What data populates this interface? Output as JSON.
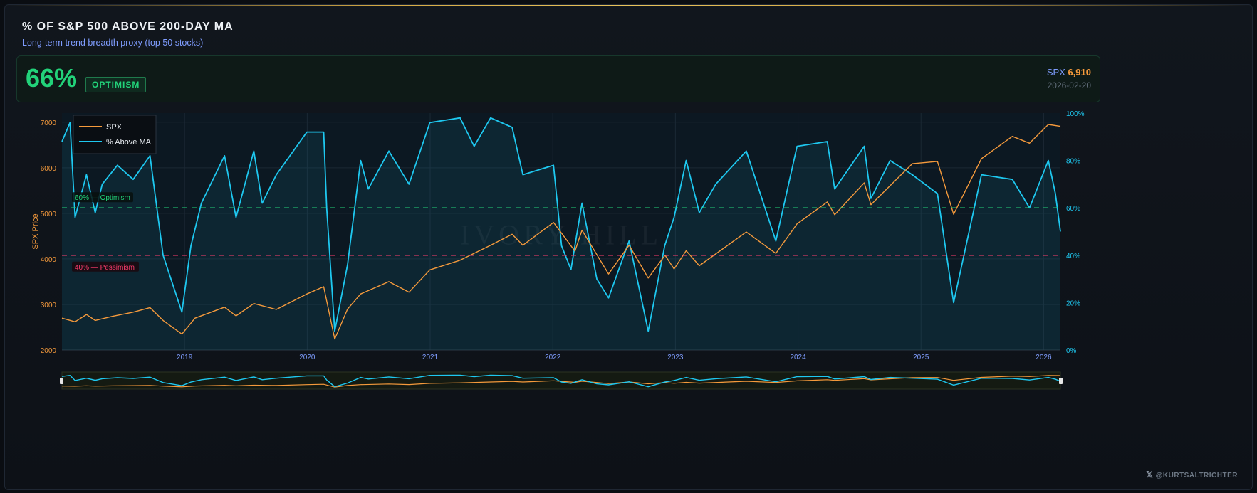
{
  "header": {
    "title": "% OF S&P 500 ABOVE 200-DAY MA",
    "subtitle": "Long-term trend breadth proxy (top 50 stocks)"
  },
  "status": {
    "percent": "66%",
    "badge": "OPTIMISM",
    "spx_label": "SPX",
    "spx_value": "6,910",
    "date": "2026-02-20"
  },
  "legend": {
    "spx": "SPX",
    "breadth": "% Above MA"
  },
  "thresholds": {
    "optimism_label": "60% — Optimism",
    "pessimism_label": "40% — Pessimism"
  },
  "watermark": "IVORY HILL",
  "footer": {
    "credit": "@KURTSALTRICHTER",
    "x_icon": "x-logo-icon"
  },
  "colors": {
    "spx": "#f59a3c",
    "breadth": "#1ec8f0",
    "optimism": "#22d37a",
    "pessimism": "#ff3d6e",
    "left_axis": "#f59a3c",
    "right_axis": "#1ec8f0",
    "x_axis": "#7f9dff"
  },
  "chart_data": {
    "type": "line",
    "title": "% OF S&P 500 ABOVE 200-DAY MA",
    "x_axis": {
      "type": "time",
      "range": [
        "2018-01-01",
        "2026-02-20"
      ],
      "ticks": [
        "2019",
        "2020",
        "2021",
        "2022",
        "2023",
        "2024",
        "2025",
        "2026"
      ]
    },
    "y_left": {
      "label": "SPX Price",
      "range": [
        2000,
        7200
      ],
      "ticks": [
        2000,
        3000,
        4000,
        5000,
        6000,
        7000
      ]
    },
    "y_right": {
      "range": [
        0,
        100
      ],
      "ticks": [
        "0%",
        "20%",
        "40%",
        "60%",
        "80%",
        "100%"
      ]
    },
    "thresholds": [
      {
        "value": 60,
        "label": "60% — Optimism"
      },
      {
        "value": 40,
        "label": "40% — Pessimism"
      }
    ],
    "grid": true,
    "legend": "top-left",
    "series": [
      {
        "name": "SPX",
        "axis": "left",
        "points": [
          [
            "2018-01-01",
            2700
          ],
          [
            "2018-02-09",
            2620
          ],
          [
            "2018-03-15",
            2780
          ],
          [
            "2018-04-10",
            2650
          ],
          [
            "2018-06-01",
            2740
          ],
          [
            "2018-08-01",
            2830
          ],
          [
            "2018-09-20",
            2930
          ],
          [
            "2018-10-29",
            2650
          ],
          [
            "2018-12-24",
            2350
          ],
          [
            "2019-02-01",
            2700
          ],
          [
            "2019-04-30",
            2940
          ],
          [
            "2019-06-03",
            2750
          ],
          [
            "2019-07-26",
            3020
          ],
          [
            "2019-10-01",
            2890
          ],
          [
            "2019-12-31",
            3230
          ],
          [
            "2020-02-19",
            3390
          ],
          [
            "2020-03-23",
            2240
          ],
          [
            "2020-04-30",
            2900
          ],
          [
            "2020-06-08",
            3230
          ],
          [
            "2020-08-31",
            3500
          ],
          [
            "2020-10-30",
            3270
          ],
          [
            "2020-12-31",
            3760
          ],
          [
            "2021-03-31",
            3970
          ],
          [
            "2021-06-30",
            4300
          ],
          [
            "2021-09-02",
            4540
          ],
          [
            "2021-10-04",
            4300
          ],
          [
            "2022-01-03",
            4800
          ],
          [
            "2022-03-08",
            4170
          ],
          [
            "2022-03-29",
            4630
          ],
          [
            "2022-06-16",
            3670
          ],
          [
            "2022-08-16",
            4300
          ],
          [
            "2022-10-12",
            3580
          ],
          [
            "2022-12-01",
            4080
          ],
          [
            "2022-12-28",
            3780
          ],
          [
            "2023-02-02",
            4180
          ],
          [
            "2023-03-13",
            3850
          ],
          [
            "2023-07-31",
            4590
          ],
          [
            "2023-10-27",
            4120
          ],
          [
            "2023-12-29",
            4770
          ],
          [
            "2024-03-28",
            5250
          ],
          [
            "2024-04-19",
            4970
          ],
          [
            "2024-07-16",
            5670
          ],
          [
            "2024-08-05",
            5190
          ],
          [
            "2024-12-06",
            6090
          ],
          [
            "2025-02-19",
            6140
          ],
          [
            "2025-04-08",
            4980
          ],
          [
            "2025-06-30",
            6200
          ],
          [
            "2025-09-30",
            6690
          ],
          [
            "2025-11-20",
            6540
          ],
          [
            "2026-01-15",
            6950
          ],
          [
            "2026-02-20",
            6910
          ]
        ]
      },
      {
        "name": "% Above MA",
        "axis": "right",
        "points": [
          [
            "2018-01-01",
            88
          ],
          [
            "2018-01-25",
            96
          ],
          [
            "2018-02-09",
            56
          ],
          [
            "2018-03-15",
            74
          ],
          [
            "2018-04-10",
            58
          ],
          [
            "2018-05-01",
            70
          ],
          [
            "2018-06-15",
            78
          ],
          [
            "2018-08-01",
            72
          ],
          [
            "2018-09-20",
            82
          ],
          [
            "2018-10-29",
            40
          ],
          [
            "2018-12-24",
            16
          ],
          [
            "2019-01-20",
            44
          ],
          [
            "2019-02-20",
            62
          ],
          [
            "2019-04-30",
            82
          ],
          [
            "2019-06-03",
            56
          ],
          [
            "2019-07-26",
            84
          ],
          [
            "2019-08-20",
            62
          ],
          [
            "2019-10-01",
            74
          ],
          [
            "2019-12-31",
            92
          ],
          [
            "2020-02-19",
            92
          ],
          [
            "2020-02-28",
            60
          ],
          [
            "2020-03-23",
            8
          ],
          [
            "2020-04-30",
            36
          ],
          [
            "2020-06-08",
            80
          ],
          [
            "2020-07-01",
            68
          ],
          [
            "2020-08-31",
            84
          ],
          [
            "2020-10-30",
            70
          ],
          [
            "2020-12-31",
            96
          ],
          [
            "2021-03-31",
            98
          ],
          [
            "2021-05-12",
            86
          ],
          [
            "2021-06-30",
            98
          ],
          [
            "2021-09-02",
            94
          ],
          [
            "2021-10-04",
            74
          ],
          [
            "2022-01-03",
            78
          ],
          [
            "2022-01-27",
            44
          ],
          [
            "2022-02-24",
            34
          ],
          [
            "2022-03-29",
            62
          ],
          [
            "2022-05-12",
            30
          ],
          [
            "2022-06-16",
            22
          ],
          [
            "2022-08-16",
            46
          ],
          [
            "2022-10-12",
            8
          ],
          [
            "2022-11-30",
            44
          ],
          [
            "2022-12-28",
            56
          ],
          [
            "2023-02-02",
            80
          ],
          [
            "2023-03-13",
            58
          ],
          [
            "2023-05-01",
            70
          ],
          [
            "2023-07-31",
            84
          ],
          [
            "2023-10-27",
            46
          ],
          [
            "2023-12-29",
            86
          ],
          [
            "2024-03-28",
            88
          ],
          [
            "2024-04-19",
            68
          ],
          [
            "2024-07-16",
            86
          ],
          [
            "2024-08-05",
            64
          ],
          [
            "2024-10-01",
            80
          ],
          [
            "2024-12-06",
            74
          ],
          [
            "2025-02-19",
            66
          ],
          [
            "2025-04-08",
            20
          ],
          [
            "2025-06-30",
            74
          ],
          [
            "2025-09-30",
            72
          ],
          [
            "2025-11-20",
            60
          ],
          [
            "2026-01-15",
            80
          ],
          [
            "2026-02-05",
            66
          ],
          [
            "2026-02-20",
            50
          ]
        ]
      }
    ]
  }
}
